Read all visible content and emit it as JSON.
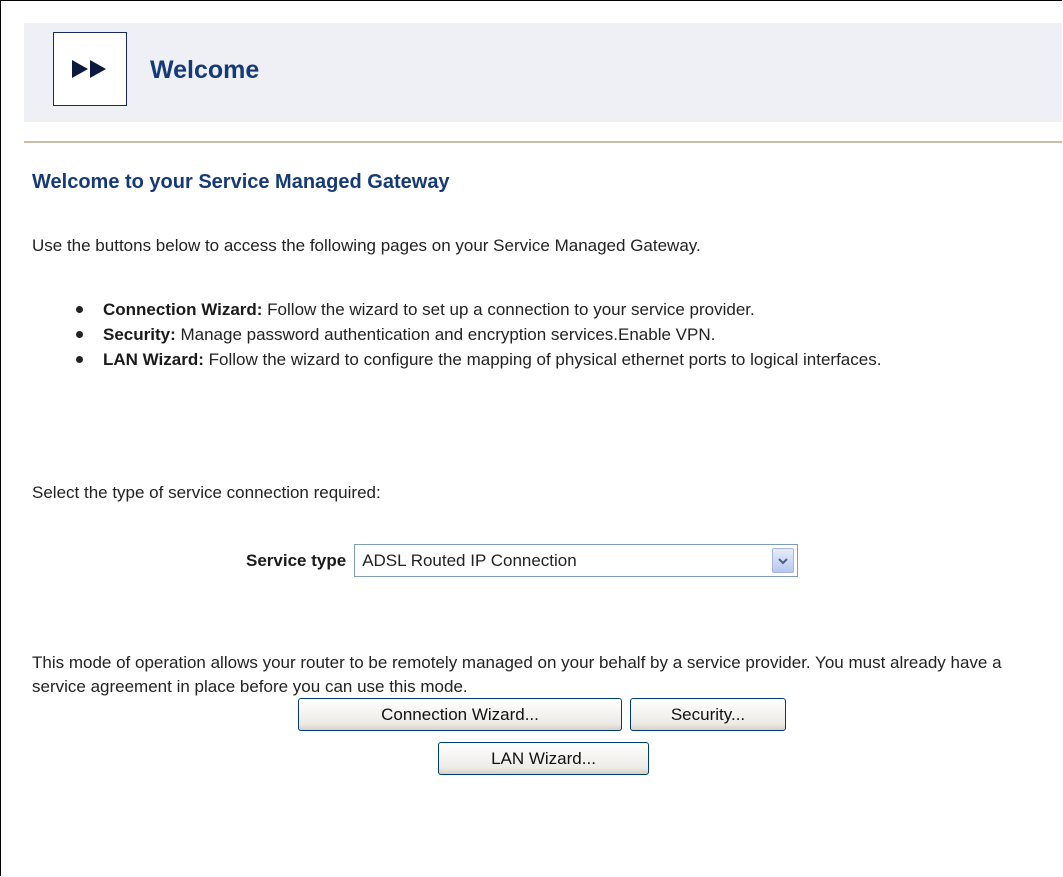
{
  "header": {
    "title": "Welcome",
    "icon": "fast-forward-icon"
  },
  "page": {
    "title": "Welcome to your Service Managed Gateway",
    "intro": "Use the buttons below to access the following pages on your Service Managed Gateway."
  },
  "bullets": [
    {
      "term": "Connection Wizard:",
      "text": " Follow the wizard to set up a connection to your service provider."
    },
    {
      "term": "Security:",
      "text": " Manage password authentication and encryption services.Enable VPN."
    },
    {
      "term": "LAN Wizard:",
      "text": " Follow the wizard to configure the mapping of physical ethernet ports to logical interfaces."
    }
  ],
  "service": {
    "prompt": "Select the type of service connection required:",
    "label": "Service type",
    "selected": "ADSL Routed IP Connection"
  },
  "mode_text": "This mode of operation allows your router to be remotely managed on your behalf by a service provider. You must already have a service agreement in place before you can use this mode.",
  "buttons": {
    "connection_wizard": "Connection Wizard...",
    "security": "Security...",
    "lan_wizard": "LAN Wizard..."
  },
  "colors": {
    "title_blue": "#163a78",
    "header_bg": "#eef0f5",
    "divider": "#c8bfa6"
  }
}
